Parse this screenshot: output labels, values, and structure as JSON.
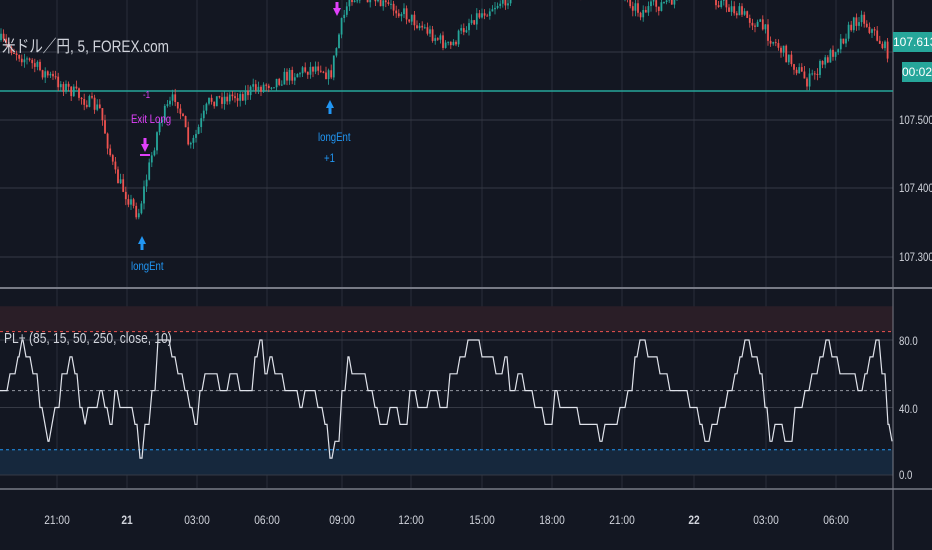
{
  "symbol": {
    "title": "米ドル／円, 5, FOREX.com"
  },
  "price_axis": {
    "labels": [
      "107.500",
      "107.400",
      "107.300"
    ],
    "current_price": "107.613",
    "countdown": "00:02"
  },
  "indicator": {
    "title": "PL+ (85, 15, 50, 250, close, 10)",
    "axis_labels": [
      "80.0",
      "40.0",
      "0.0"
    ],
    "upper": 85,
    "lower": 15,
    "mid": 50
  },
  "markers": {
    "exit_long": "Exit Long",
    "exit_qty": "-1",
    "long_entry_1": "longEnt",
    "long_entry_2": "longEnt",
    "long_entry_2_qty": "+1"
  },
  "time_axis": [
    "21:00",
    "21",
    "03:00",
    "06:00",
    "09:00",
    "12:00",
    "15:00",
    "18:00",
    "21:00",
    "22",
    "03:00",
    "06:00"
  ],
  "colors": {
    "up": "#26a69a",
    "down": "#ef5350",
    "exit": "#e040fb",
    "entry": "#2196f3",
    "bg": "#131722"
  }
}
